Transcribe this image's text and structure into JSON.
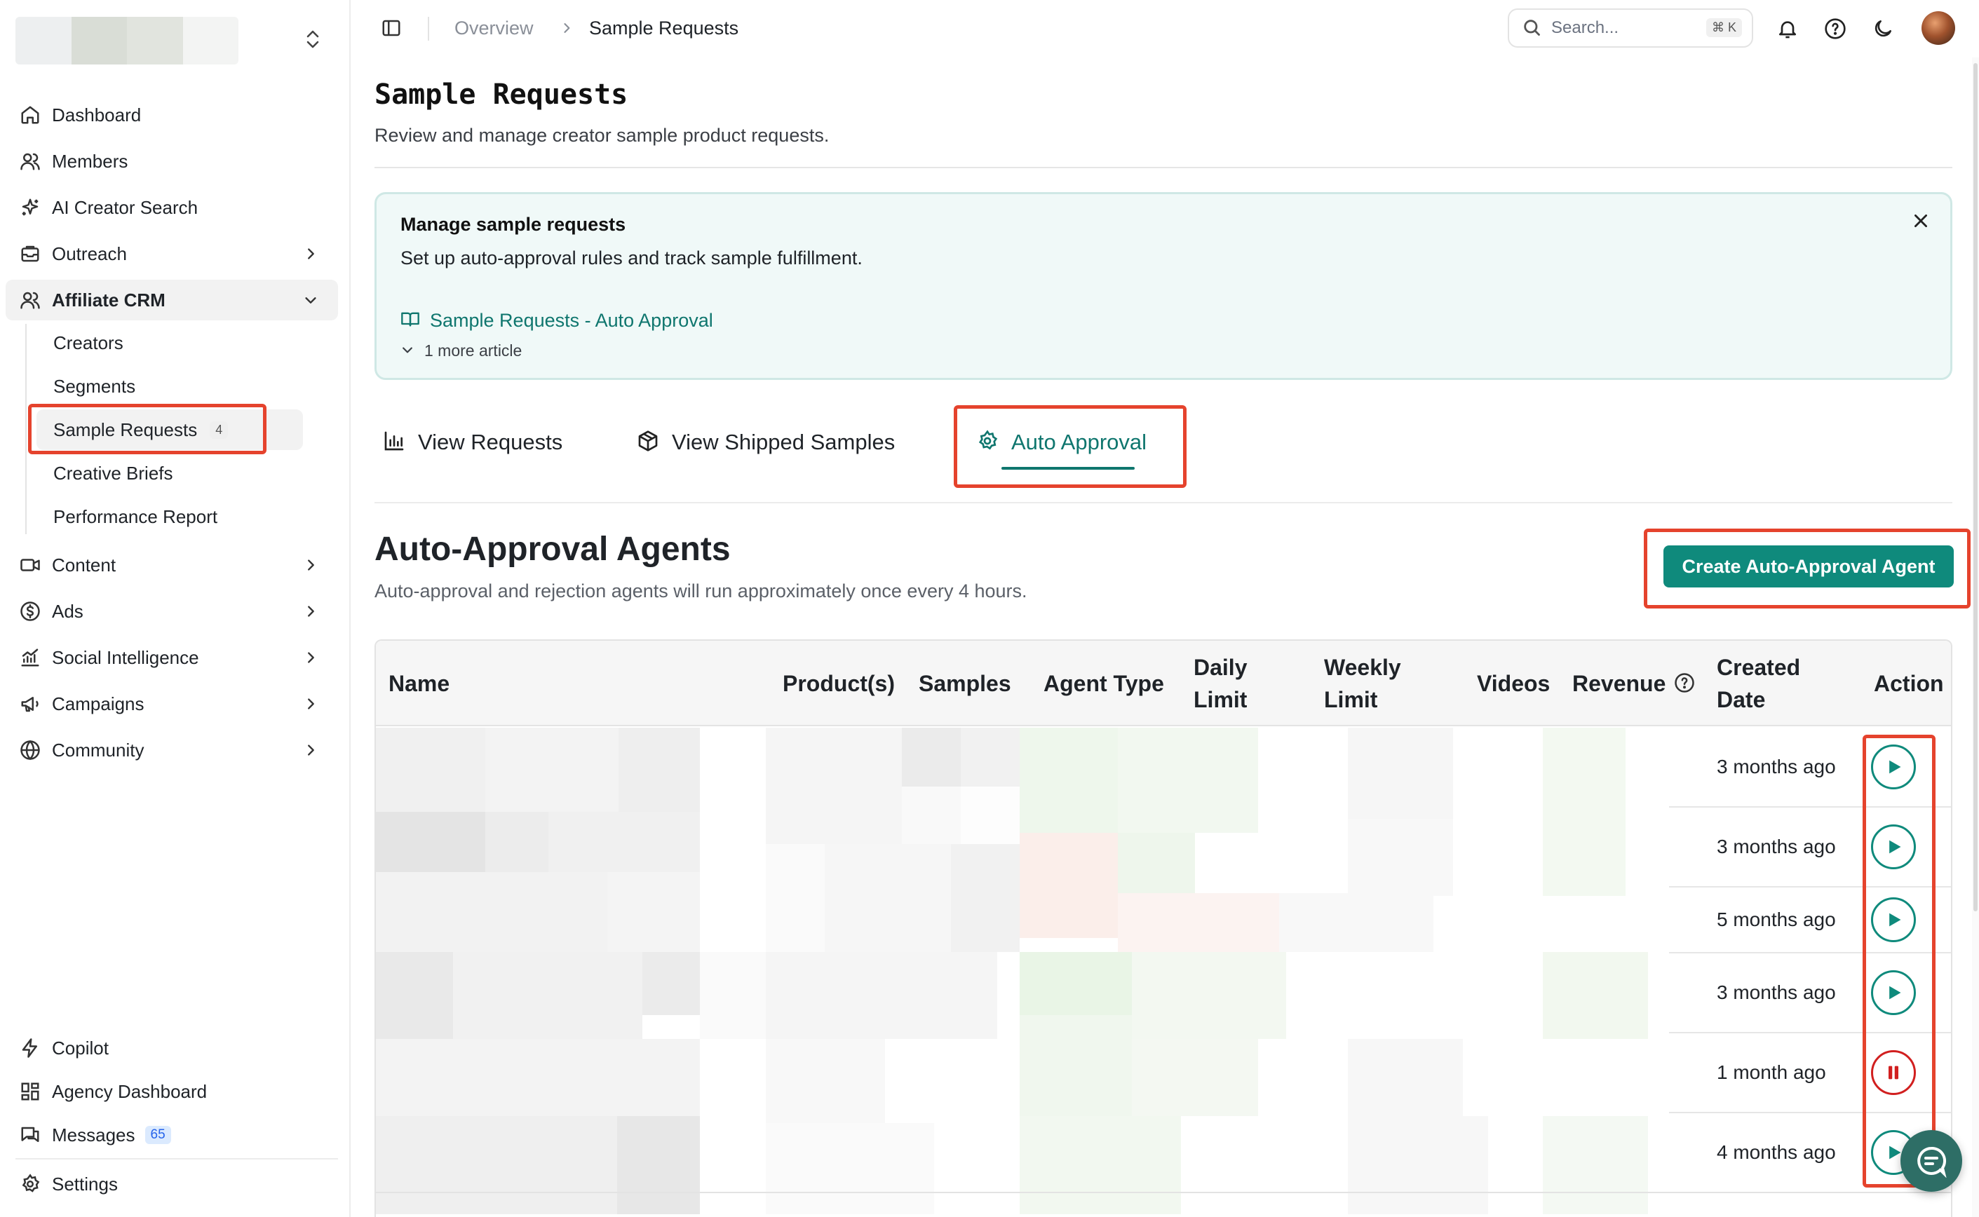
{
  "sidebar": {
    "items": [
      {
        "label": "Dashboard",
        "icon": "home-icon"
      },
      {
        "label": "Members",
        "icon": "users-icon"
      },
      {
        "label": "AI Creator Search",
        "icon": "sparkles-icon"
      },
      {
        "label": "Outreach",
        "icon": "inbox-icon"
      },
      {
        "label": "Affiliate CRM",
        "icon": "users-icon"
      },
      {
        "label": "Content",
        "icon": "video-icon"
      },
      {
        "label": "Ads",
        "icon": "dollar-icon"
      },
      {
        "label": "Social Intelligence",
        "icon": "chart-line-icon"
      },
      {
        "label": "Campaigns",
        "icon": "megaphone-icon"
      },
      {
        "label": "Community",
        "icon": "globe-icon"
      }
    ],
    "sub_items": [
      {
        "label": "Creators"
      },
      {
        "label": "Segments"
      },
      {
        "label": "Sample Requests",
        "badge": "4"
      },
      {
        "label": "Creative Briefs"
      },
      {
        "label": "Performance Report"
      }
    ],
    "bottom_items": [
      {
        "label": "Copilot",
        "icon": "bolt-icon"
      },
      {
        "label": "Agency Dashboard",
        "icon": "grid-icon"
      },
      {
        "label": "Messages",
        "icon": "messages-icon",
        "badge": "65"
      },
      {
        "label": "Settings",
        "icon": "gear-icon"
      }
    ]
  },
  "header": {
    "breadcrumb": [
      "Overview",
      "Sample Requests"
    ],
    "search_placeholder": "Search...",
    "search_shortcut": "⌘ K"
  },
  "page": {
    "title": "Sample Requests",
    "subtitle": "Review and manage creator sample product requests."
  },
  "callout": {
    "title": "Manage sample requests",
    "text": "Set up auto-approval rules and track sample fulfillment.",
    "link": "Sample Requests - Auto Approval",
    "more": "1 more article"
  },
  "tabs": [
    {
      "label": "View Requests",
      "icon": "bar-chart-icon"
    },
    {
      "label": "View Shipped Samples",
      "icon": "package-icon"
    },
    {
      "label": "Auto Approval",
      "icon": "gear-icon",
      "active": true
    }
  ],
  "section": {
    "title": "Auto-Approval Agents",
    "subtitle": "Auto-approval and rejection agents will run approximately once every 4 hours.",
    "create_button": "Create Auto-Approval Agent"
  },
  "table": {
    "columns": [
      {
        "label": "Name"
      },
      {
        "label": "Product(s)"
      },
      {
        "label": "Samples"
      },
      {
        "label": "Agent Type"
      },
      {
        "label": "Daily",
        "label2": "Limit"
      },
      {
        "label": "Weekly",
        "label2": "Limit"
      },
      {
        "label": "Videos"
      },
      {
        "label": "Revenue"
      },
      {
        "label": "Created",
        "label2": "Date"
      },
      {
        "label": "Action"
      }
    ],
    "rows": [
      {
        "created": "3 months ago",
        "action": "play"
      },
      {
        "created": "3 months ago",
        "action": "play"
      },
      {
        "created": "5 months ago",
        "action": "play"
      },
      {
        "created": "3 months ago",
        "action": "play"
      },
      {
        "created": "1 month ago",
        "action": "pause"
      },
      {
        "created": "4 months ago",
        "action": "play"
      }
    ]
  },
  "colors": {
    "accent": "#0f8a7c",
    "accent_text": "#0f766e",
    "pause": "#d11f1f",
    "annotation": "#e5432d"
  }
}
